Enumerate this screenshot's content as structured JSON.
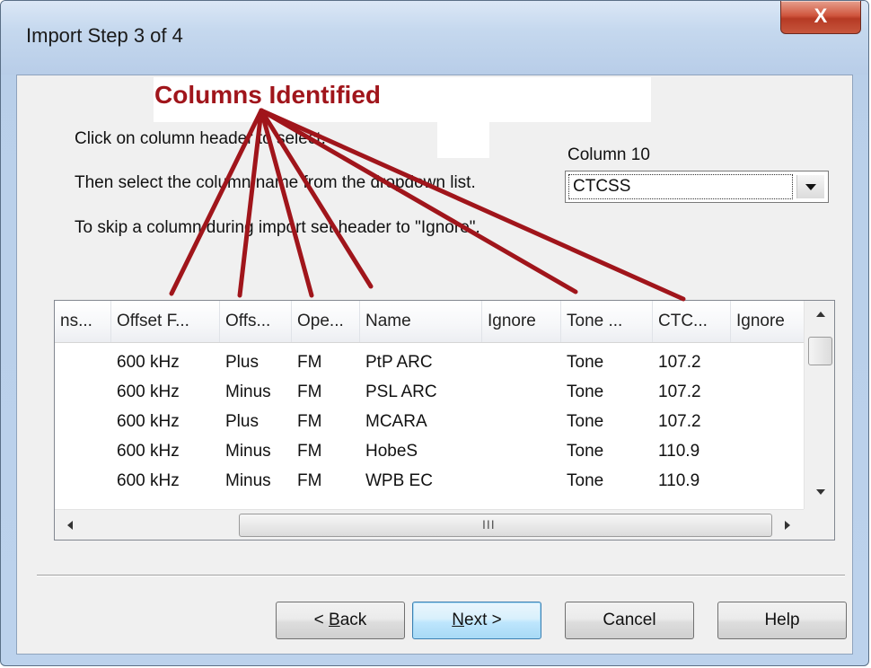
{
  "window": {
    "title": "Import Step 3 of 4",
    "close_glyph": "X"
  },
  "annotation": {
    "text": "Columns Identified",
    "color": "#a0151b"
  },
  "instructions": {
    "line1": "Click on column header to select.",
    "line2": "Then select the column name from the dropdown list.",
    "line3": "To skip a column during import set header to \"Ignore\"."
  },
  "column_selector": {
    "label": "Column 10",
    "selected": "CTCSS"
  },
  "grid": {
    "columns": [
      "ns...",
      "Offset F...",
      "Offs...",
      "Ope...",
      "Name",
      "Ignore",
      "Tone ...",
      "CTC...",
      "Ignore"
    ],
    "rows": [
      [
        "",
        "600 kHz",
        "Plus",
        "FM",
        "PtP ARC",
        "",
        "Tone",
        "107.2",
        ""
      ],
      [
        "",
        "600 kHz",
        "Minus",
        "FM",
        "PSL ARC",
        "",
        "Tone",
        "107.2",
        ""
      ],
      [
        "",
        "600 kHz",
        "Plus",
        "FM",
        "MCARA",
        "",
        "Tone",
        "107.2",
        ""
      ],
      [
        "",
        "600 kHz",
        "Minus",
        "FM",
        "HobeS",
        "",
        "Tone",
        "110.9",
        ""
      ],
      [
        "",
        "600 kHz",
        "Minus",
        "FM",
        "WPB EC",
        "",
        "Tone",
        "110.9",
        ""
      ]
    ],
    "scroll_grip": "III"
  },
  "buttons": {
    "back_accel": "B",
    "back_prefix": "< ",
    "back_rest": "ack",
    "next_accel": "N",
    "next_rest": "ext >",
    "cancel": "Cancel",
    "help": "Help"
  }
}
